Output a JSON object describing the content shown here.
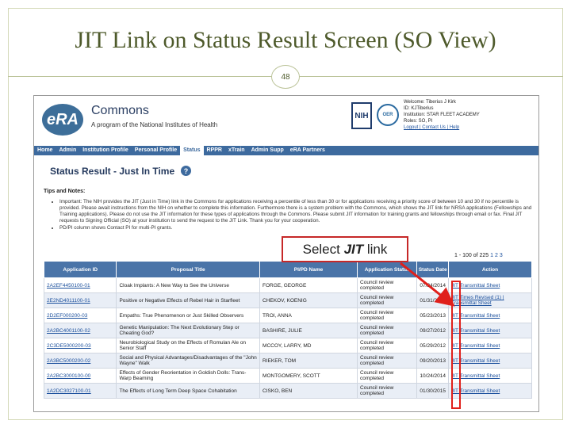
{
  "slide": {
    "title": "JIT Link on Status Result Screen (SO View)",
    "page_number": "48"
  },
  "header": {
    "logo_text": "eRA",
    "app_name": "Commons",
    "subtitle": "A program of the National Institutes of Health",
    "nih_logo": "NIH",
    "oer_logo": "OER",
    "user_lines": [
      "Welcome: Tiberius J Kirk",
      "ID: KJTiberius",
      "Institution: STAR FLEET ACADEMY",
      "Roles: SO, PI"
    ],
    "user_links": "Logout | Contact Us | Help"
  },
  "nav": [
    "Home",
    "Admin",
    "Institution Profile",
    "Personal Profile",
    "Status",
    "RPPR",
    "xTrain",
    "Admin Supp",
    "eRA Partners"
  ],
  "nav_active": "Status",
  "page_heading": "Status Result - Just In Time",
  "tips": {
    "title": "Tips and Notes:",
    "items": [
      "Important: The NIH provides the JIT (Just in Time) link in the Commons for applications receiving a percentile of less than 30 or for applications receiving a priority score of between 10 and 30 if no percentile is provided. Please await instructions from the NIH on whether to complete this information. Furthermore there is a system problem with the Commons, which shows the JIT link for NRSA applications (Fellowships and Training applications). Please do not use the JIT information for these types of applications through the Commons. Please submit JIT information for training grants and fellowships through email or fax. Final JIT requests to Signing Official (SO) at your institution to send the request to the JIT Link. Thank you for your cooperation.",
      "PD/PI column shows Contact PI for multi-PI grants."
    ]
  },
  "paging": {
    "range": "1 - 100 of 225",
    "pages": "1 2 3"
  },
  "table": {
    "headers": [
      "Application ID",
      "Proposal Title",
      "PI/PD Name",
      "Application Status",
      "Status Date",
      "Action"
    ],
    "rows": [
      {
        "id": "2A2EF4450100-01",
        "title": "Cloak Implants: A New Way to See the Universe",
        "pi": "FORGE, GEORGE",
        "status": "Council review completed",
        "date": "07/24/2014",
        "action": "JIT Transmittal Sheet"
      },
      {
        "id": "2E2ND4011100-01",
        "title": "Positive or Negative Effects of Rebel Hair in Starfleet",
        "pi": "CHEKOV, KOENIG",
        "status": "Council review completed",
        "date": "01/31/2014",
        "action": "JIT Times Revised (1) | Transmittal Sheet"
      },
      {
        "id": "2D2EF000200-03",
        "title": "Empaths: True Phenomenon or Just Skilled Observers",
        "pi": "TROI, ANNA",
        "status": "Council review completed",
        "date": "05/23/2013",
        "action": "JIT Transmittal Sheet"
      },
      {
        "id": "2A2BC4001100-02",
        "title": "Genetic Manipulation: The Next Evolutionary Step or Cheating God?",
        "pi": "BASHIRE, JULIE",
        "status": "Council review completed",
        "date": "09/27/2012",
        "action": "JIT Transmittal Sheet"
      },
      {
        "id": "2C3DE5000200-03",
        "title": "Neurobiological Study on the Effects of Romulan Ale on Senior Staff",
        "pi": "MCCOY, LARRY, MD",
        "status": "Council review completed",
        "date": "05/29/2012",
        "action": "JIT Transmittal Sheet"
      },
      {
        "id": "2A3BC5000200-02",
        "title": "Social and Physical Advantages/Disadvantages of the \"John Wayne\" Walk",
        "pi": "RIEKER, TOM",
        "status": "Council review completed",
        "date": "09/20/2013",
        "action": "JIT Transmittal Sheet"
      },
      {
        "id": "2A2BC3000100-00",
        "title": "Effects of Gender Reorientation in Goldish Dolls: Trans-Warp Beaming",
        "pi": "MONTGOMERY, SCOTT",
        "status": "Council review completed",
        "date": "10/24/2014",
        "action": "JIT Transmittal Sheet"
      },
      {
        "id": "1A2DC3027100-01",
        "title": "The Effects of Long Term Deep Space Cohabitation",
        "pi": "CISKO, BEN",
        "status": "Council review completed",
        "date": "01/30/2015",
        "action": "JIT Transmittal Sheet"
      }
    ]
  },
  "annotation": {
    "prefix": "Select ",
    "emphasis": "JIT",
    "suffix": " link"
  },
  "colors": {
    "slide_title": "#4e5a2b",
    "nav_bar": "#3d6a9e",
    "table_header": "#4a74a8",
    "annotation_red": "#e0201b"
  }
}
